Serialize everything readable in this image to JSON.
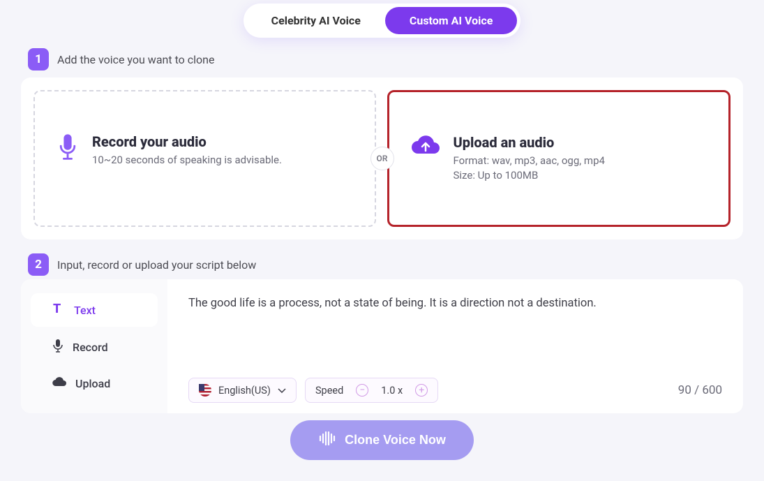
{
  "toggle": {
    "celebrity": "Celebrity AI Voice",
    "custom": "Custom AI Voice"
  },
  "step1": {
    "num": "1",
    "title": "Add the voice you want to clone",
    "record": {
      "heading": "Record your audio",
      "desc": "10~20 seconds of speaking is advisable."
    },
    "upload": {
      "heading": "Upload an audio",
      "format": "Format: wav, mp3, aac, ogg, mp4",
      "size": "Size: Up to 100MB"
    },
    "or": "OR"
  },
  "step2": {
    "num": "2",
    "title": "Input, record or upload your script below",
    "tabs": {
      "text": "Text",
      "record": "Record",
      "upload": "Upload"
    },
    "script": "The good life is a process, not a state of being. It is a direction not a destination.",
    "language": "English(US)",
    "speed_label": "Speed",
    "speed_value": "1.0 x",
    "counter": "90 / 600"
  },
  "cta": "Clone Voice Now"
}
